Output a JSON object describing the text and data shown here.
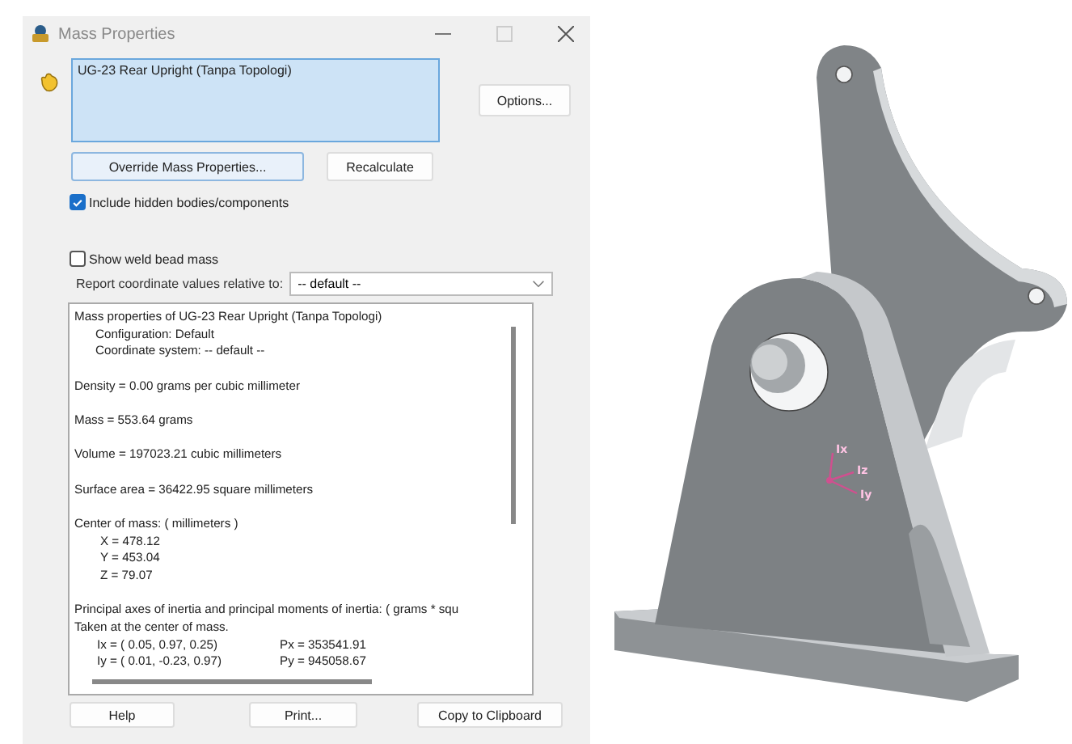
{
  "window": {
    "title": "Mass Properties"
  },
  "selection": {
    "value": "UG-23 Rear Upright (Tanpa Topologi)"
  },
  "buttons_top": {
    "options": "Options...",
    "override": "Override Mass Properties...",
    "recalculate": "Recalculate"
  },
  "checkboxes": [
    {
      "label": "Include hidden bodies/components",
      "checked": true
    },
    {
      "label": "Show weld bead mass",
      "checked": false
    }
  ],
  "coordinate_row": {
    "label": "Report coordinate values relative to:",
    "value": "-- default --"
  },
  "report": [
    [
      {
        "kind": "plain",
        "text": "Mass properties of UG-23 Rear Upright (Tanpa Topologi)"
      },
      {
        "kind": "indent",
        "text": "Configuration: Default"
      },
      {
        "kind": "indent",
        "text": "Coordinate system: -- default --"
      }
    ],
    [
      {
        "kind": "plain",
        "text": "Density = 0.00 grams per cubic millimeter"
      }
    ],
    [
      {
        "kind": "plain",
        "text": "Mass = 553.64 grams"
      }
    ],
    [
      {
        "kind": "plain",
        "text": "Volume = 197023.21 cubic millimeters"
      }
    ],
    [
      {
        "kind": "plain",
        "text": "Surface area = 36422.95  square millimeters"
      }
    ],
    [
      {
        "kind": "plain",
        "text": "Center of mass: ( millimeters )"
      },
      {
        "kind": "deep",
        "text": "X = 478.12"
      },
      {
        "kind": "deep",
        "text": "Y = 453.04"
      },
      {
        "kind": "deep",
        "text": "Z = 79.07"
      }
    ],
    [
      {
        "kind": "plain",
        "text": "Principal axes of inertia and principal moments of inertia: ( grams *  squ"
      },
      {
        "kind": "plain",
        "text": "Taken at the center of mass."
      },
      {
        "kind": "pair",
        "text": "Ix = ( 0.05,  0.97,  0.25)",
        "value": "Px = 353541.91"
      },
      {
        "kind": "pair",
        "text": "Iy = ( 0.01, -0.23,  0.97)",
        "value": "Py = 945058.67"
      }
    ]
  ],
  "buttons_bottom": [
    "Help",
    "Print...",
    "Copy to Clipboard"
  ],
  "viewport": {
    "axis_labels": [
      "Ix",
      "Iz",
      "Iy"
    ]
  }
}
